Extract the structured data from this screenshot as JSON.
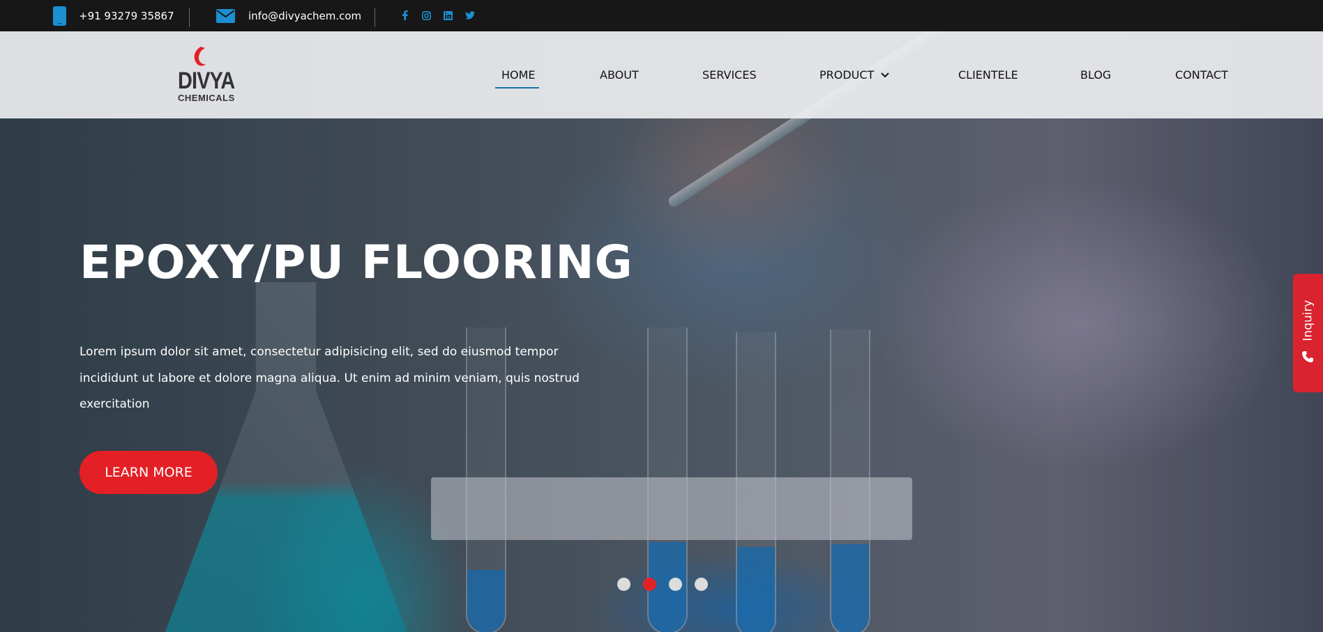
{
  "topbar": {
    "phone": "+91 93279 35867",
    "email": "info@divyachem.com",
    "social_icons": [
      "facebook-icon",
      "instagram-icon",
      "linkedin-icon",
      "twitter-icon"
    ],
    "icon_color": "#1b8fd0"
  },
  "brand": {
    "name": "DIVYA",
    "subtitle": "CHEMICALS",
    "accent": "#e32026"
  },
  "nav": {
    "items": [
      {
        "label": "HOME",
        "active": true
      },
      {
        "label": "ABOUT"
      },
      {
        "label": "SERVICES"
      },
      {
        "label": "PRODUCT",
        "has_dropdown": true
      },
      {
        "label": "CLIENTELE"
      },
      {
        "label": "BLOG"
      },
      {
        "label": "CONTACT"
      }
    ]
  },
  "hero": {
    "title": "EPOXY/PU FLOORING",
    "text": "Lorem ipsum dolor sit amet, consectetur adipisicing elit, sed do eiusmod tempor incididunt ut labore et dolore magna aliqua. Ut enim ad minim veniam, quis nostrud exercitation",
    "button_label": "LEARN MORE",
    "slide_count": 4,
    "active_slide": 2
  },
  "inquiry": {
    "label": "Inquiry",
    "icon": "phone-icon"
  }
}
